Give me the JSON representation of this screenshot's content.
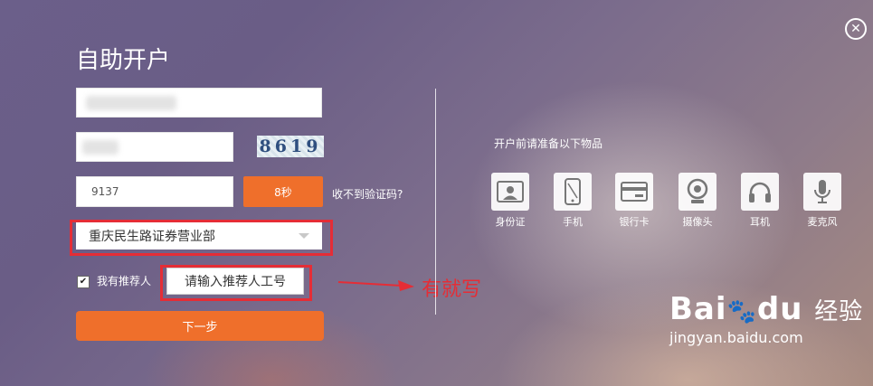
{
  "title": "自助开户",
  "form": {
    "code_value": "9137",
    "captcha_text": "8619",
    "countdown_label": "8秒",
    "no_code_link": "收不到验证码?",
    "branch_selected": "重庆民生路证券营业部",
    "has_referrer_label": "我有推荐人",
    "referrer_placeholder": "请输入推荐人工号",
    "next_label": "下一步"
  },
  "annotation_text": "有就写",
  "prep": {
    "title": "开户前请准备以下物品",
    "items": [
      {
        "label": "身份证",
        "icon": "id-card-icon"
      },
      {
        "label": "手机",
        "icon": "phone-icon"
      },
      {
        "label": "银行卡",
        "icon": "bank-card-icon"
      },
      {
        "label": "摄像头",
        "icon": "webcam-icon"
      },
      {
        "label": "耳机",
        "icon": "headphones-icon"
      },
      {
        "label": "麦克风",
        "icon": "microphone-icon"
      }
    ]
  },
  "watermark": {
    "brand": "Bai",
    "brand_suffix": "du",
    "brand_cn": "经验",
    "url": "jingyan.baidu.com"
  },
  "colors": {
    "accent": "#ef6f2b",
    "highlight": "#e52d36"
  }
}
